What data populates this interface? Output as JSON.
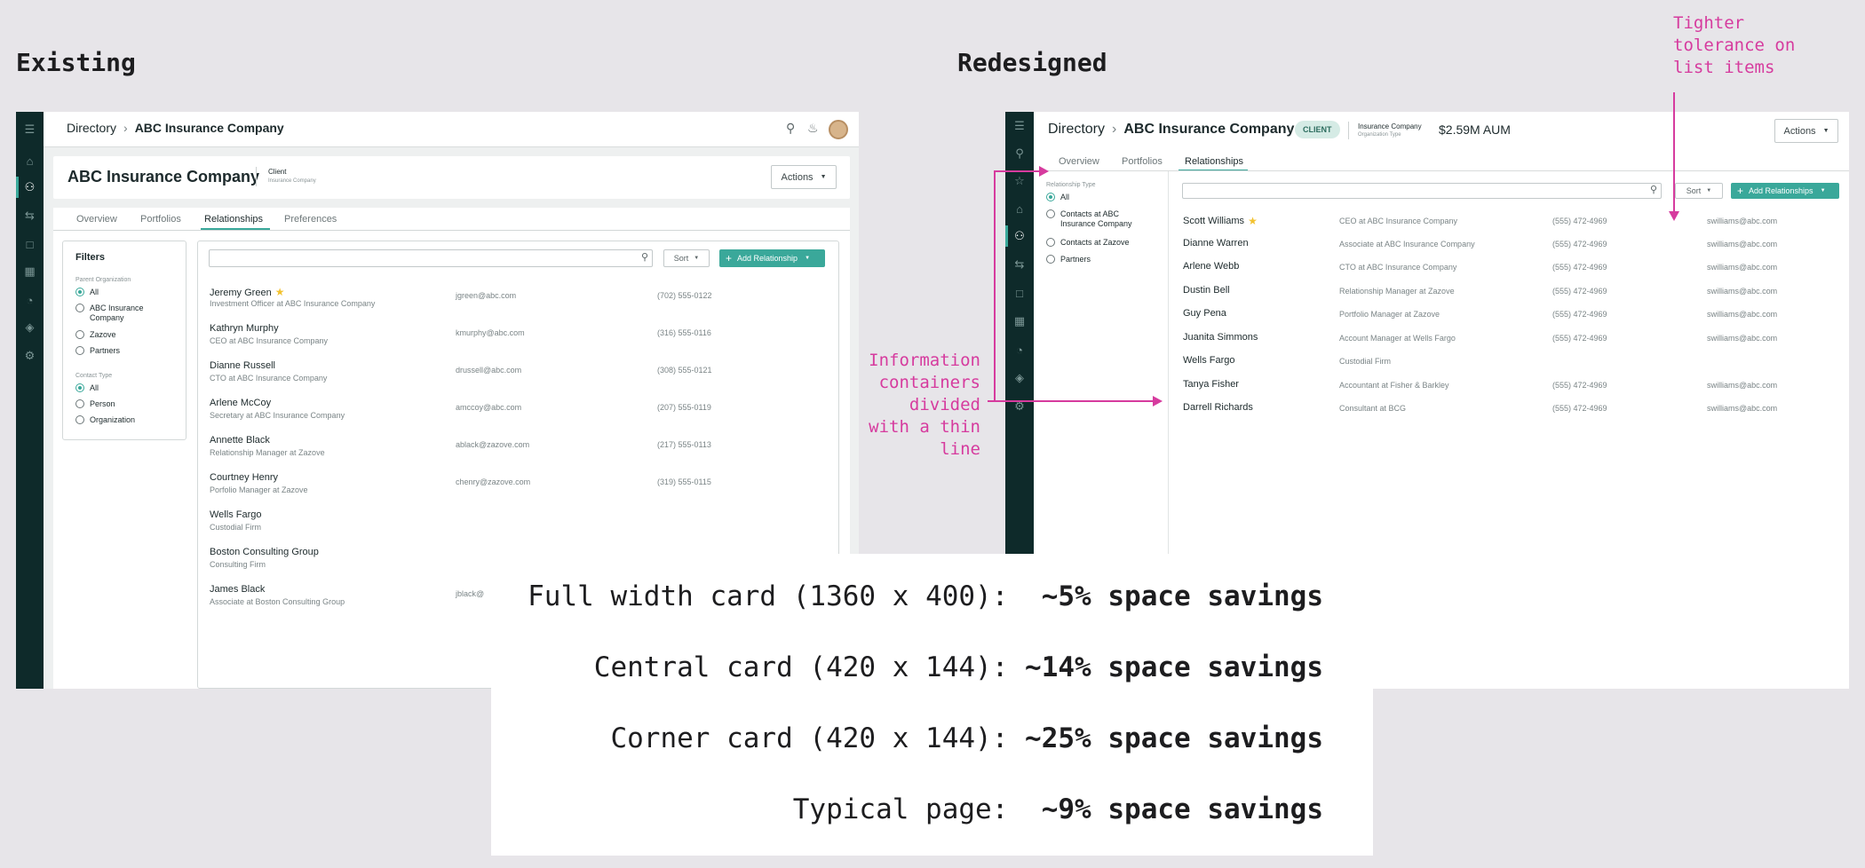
{
  "headings": {
    "existing": "Existing",
    "redesigned": "Redesigned"
  },
  "annotations": {
    "tolerance": "Tighter\ntolerance on\nlist items",
    "containers": "Information\ncontainers\ndivided\nwith a thin\nline"
  },
  "colors": {
    "accent": "#3aa89a",
    "rail": "#0e2a2a",
    "annotation": "#d63b9e",
    "badge_bg": "#d5ebe5"
  },
  "icons": {
    "rail": [
      "menu-icon",
      "home-icon",
      "users-icon",
      "transfer-icon",
      "folder-icon",
      "calculator-icon",
      "pie-chart-icon",
      "layers-icon",
      "gear-icon"
    ],
    "top": [
      "search-icon",
      "bell-icon",
      "avatar"
    ]
  },
  "existing": {
    "breadcrumb": {
      "parent": "Directory",
      "current": "ABC Insurance Company"
    },
    "title": "ABC Insurance Company",
    "type_label": "Client",
    "type_sub": "Insurance Company",
    "actions_label": "Actions",
    "tabs": [
      "Overview",
      "Portfolios",
      "Relationships",
      "Preferences"
    ],
    "filters": {
      "title": "Filters",
      "group1": {
        "label": "Parent Organization",
        "options": [
          "All",
          "ABC Insurance\nCompany",
          "Zazove",
          "Partners"
        ]
      },
      "group2": {
        "label": "Contact Type",
        "options": [
          "All",
          "Person",
          "Organization"
        ]
      }
    },
    "sort_label": "Sort",
    "add_label": "Add Relationship",
    "rows": [
      {
        "name": "Jeremy Green",
        "starred": true,
        "role": "Investment Officer at ABC Insurance Company",
        "email": "jgreen@abc.com",
        "phone": "(702) 555-0122"
      },
      {
        "name": "Kathryn Murphy",
        "role": "CEO at ABC Insurance Company",
        "email": "kmurphy@abc.com",
        "phone": "(316) 555-0116"
      },
      {
        "name": "Dianne Russell",
        "role": "CTO at ABC Insurance Company",
        "email": "drussell@abc.com",
        "phone": "(308) 555-0121"
      },
      {
        "name": "Arlene McCoy",
        "role": "Secretary at ABC Insurance Company",
        "email": "amccoy@abc.com",
        "phone": "(207) 555-0119"
      },
      {
        "name": "Annette Black",
        "role": "Relationship Manager at Zazove",
        "email": "ablack@zazove.com",
        "phone": "(217) 555-0113"
      },
      {
        "name": "Courtney Henry",
        "role": "Porfolio Manager at Zazove",
        "email": "chenry@zazove.com",
        "phone": "(319) 555-0115"
      },
      {
        "name": "Wells Fargo",
        "role": "Custodial Firm",
        "email": "",
        "phone": ""
      },
      {
        "name": "Boston Consulting Group",
        "role": "Consulting Firm",
        "email": "",
        "phone": ""
      },
      {
        "name": "James Black",
        "role": "Associate at Boston Consulting Group",
        "email": "jblack@",
        "phone": ""
      }
    ]
  },
  "redesigned": {
    "breadcrumb": {
      "parent": "Directory",
      "current": "ABC Insurance Company"
    },
    "badge": "CLIENT",
    "type_label": "Insurance Company",
    "type_sub": "Organization Type",
    "aum": "$2.59M AUM",
    "actions_label": "Actions",
    "tabs": [
      "Overview",
      "Portfolios",
      "Relationships"
    ],
    "filter": {
      "label": "Relationship Type",
      "options": [
        "All",
        "Contacts at ABC\nInsurance Company",
        "Contacts at Zazove",
        "Partners"
      ]
    },
    "sort_label": "Sort",
    "add_label": "Add Relationships",
    "rows": [
      {
        "name": "Scott Williams",
        "starred": true,
        "role": "CEO at ABC Insurance Company",
        "phone": "(555) 472-4969",
        "email": "swilliams@abc.com"
      },
      {
        "name": "Dianne Warren",
        "role": "Associate at ABC Insurance Company",
        "phone": "(555) 472-4969",
        "email": "swilliams@abc.com"
      },
      {
        "name": "Arlene Webb",
        "role": "CTO at ABC Insurance Company",
        "phone": "(555) 472-4969",
        "email": "swilliams@abc.com"
      },
      {
        "name": "Dustin Bell",
        "role": "Relationship Manager at Zazove",
        "phone": "(555) 472-4969",
        "email": "swilliams@abc.com"
      },
      {
        "name": "Guy Pena",
        "role": "Portfolio Manager at Zazove",
        "phone": "(555) 472-4969",
        "email": "swilliams@abc.com"
      },
      {
        "name": "Juanita Simmons",
        "role": "Account Manager at Wells Fargo",
        "phone": "(555) 472-4969",
        "email": "swilliams@abc.com"
      },
      {
        "name": "Wells Fargo",
        "role": "Custodial Firm",
        "phone": "",
        "email": ""
      },
      {
        "name": "Tanya Fisher",
        "role": "Accountant at Fisher & Barkley",
        "phone": "(555) 472-4969",
        "email": "swilliams@abc.com"
      },
      {
        "name": "Darrell Richards",
        "role": "Consultant at BCG",
        "phone": "(555) 472-4969",
        "email": "swilliams@abc.com"
      }
    ]
  },
  "stats": [
    {
      "label": "Full width card (1360 x 400):  ",
      "value": "~5% space savings"
    },
    {
      "label": "Central card (420 x 144): ",
      "value": "~14% space savings"
    },
    {
      "label": "Corner card (420 x 144): ",
      "value": "~25% space savings"
    },
    {
      "label": "Typical page:  ",
      "value": "~9% space savings"
    }
  ]
}
